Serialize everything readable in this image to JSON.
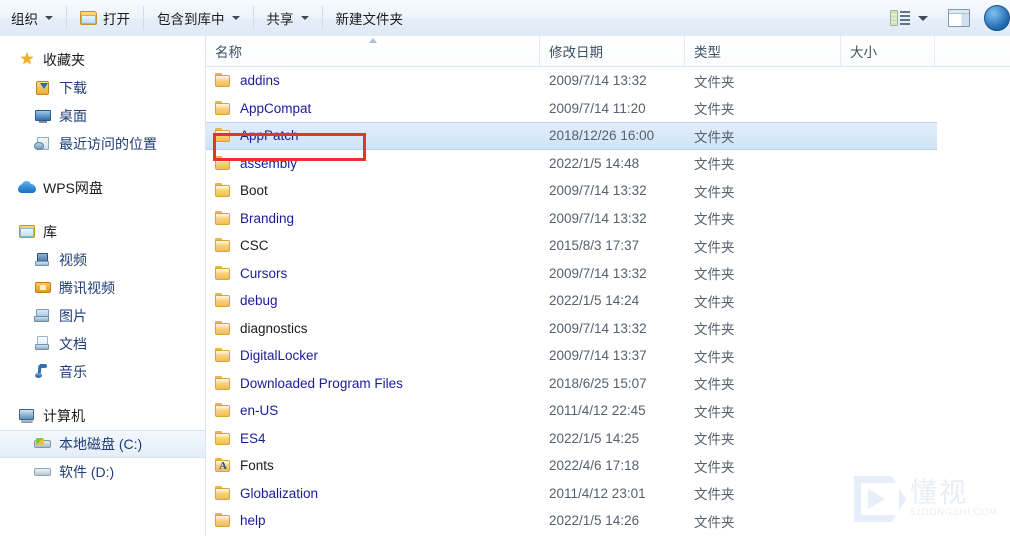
{
  "toolbar": {
    "items": [
      {
        "label": "组织",
        "icon": "none",
        "caret": true
      },
      {
        "label": "打开",
        "icon": "open-folder-icon",
        "caret": false
      },
      {
        "label": "包含到库中",
        "icon": "none",
        "caret": true
      },
      {
        "label": "共享",
        "icon": "none",
        "caret": true
      },
      {
        "label": "新建文件夹",
        "icon": "none",
        "caret": false
      }
    ],
    "right": {
      "view_icon": "view-mode-icon",
      "view_caret": "chevron-down-icon",
      "preview_pane_icon": "preview-pane-icon",
      "help_icon": "help-icon"
    }
  },
  "sidebar": {
    "groups": [
      {
        "root": {
          "label": "收藏夹",
          "icon": "star-icon"
        },
        "children": [
          {
            "label": "下载",
            "icon": "download-icon"
          },
          {
            "label": "桌面",
            "icon": "desktop-icon"
          },
          {
            "label": "最近访问的位置",
            "icon": "recent-places-icon"
          }
        ]
      },
      {
        "root": {
          "label": "WPS网盘",
          "icon": "cloud-icon"
        },
        "children": []
      },
      {
        "root": {
          "label": "库",
          "icon": "library-icon"
        },
        "children": [
          {
            "label": "视频",
            "icon": "video-icon"
          },
          {
            "label": "腾讯视频",
            "icon": "folder-orange-icon"
          },
          {
            "label": "图片",
            "icon": "pictures-icon"
          },
          {
            "label": "文档",
            "icon": "documents-icon"
          },
          {
            "label": "音乐",
            "icon": "music-icon"
          }
        ]
      },
      {
        "root": {
          "label": "计算机",
          "icon": "computer-icon"
        },
        "children": [
          {
            "label": "本地磁盘 (C:)",
            "icon": "hard-drive-windows-icon",
            "selected": true
          },
          {
            "label": "软件 (D:)",
            "icon": "hard-drive-icon",
            "selected": false
          }
        ]
      }
    ]
  },
  "file_list": {
    "columns": [
      {
        "label": "名称",
        "sorted": "asc"
      },
      {
        "label": "修改日期",
        "sorted": "none"
      },
      {
        "label": "类型",
        "sorted": "none"
      },
      {
        "label": "大小",
        "sorted": "none"
      }
    ],
    "rows": [
      {
        "name": "addins",
        "date": "2009/7/14 13:32",
        "type": "文件夹",
        "size": "",
        "icon": "folder-icon",
        "name_color": "blue",
        "selected": false
      },
      {
        "name": "AppCompat",
        "date": "2009/7/14 11:20",
        "type": "文件夹",
        "size": "",
        "icon": "folder-icon",
        "name_color": "blue",
        "selected": false
      },
      {
        "name": "AppPatch",
        "date": "2018/12/26 16:00",
        "type": "文件夹",
        "size": "",
        "icon": "folder-icon",
        "name_color": "blue",
        "selected": true
      },
      {
        "name": "assembly",
        "date": "2022/1/5 14:48",
        "type": "文件夹",
        "size": "",
        "icon": "folder-icon",
        "name_color": "blue",
        "selected": false
      },
      {
        "name": "Boot",
        "date": "2009/7/14 13:32",
        "type": "文件夹",
        "size": "",
        "icon": "folder-icon",
        "name_color": "dark",
        "selected": false
      },
      {
        "name": "Branding",
        "date": "2009/7/14 13:32",
        "type": "文件夹",
        "size": "",
        "icon": "folder-icon",
        "name_color": "blue",
        "selected": false
      },
      {
        "name": "CSC",
        "date": "2015/8/3 17:37",
        "type": "文件夹",
        "size": "",
        "icon": "folder-icon",
        "name_color": "dark",
        "selected": false
      },
      {
        "name": "Cursors",
        "date": "2009/7/14 13:32",
        "type": "文件夹",
        "size": "",
        "icon": "folder-icon",
        "name_color": "blue",
        "selected": false
      },
      {
        "name": "debug",
        "date": "2022/1/5 14:24",
        "type": "文件夹",
        "size": "",
        "icon": "folder-icon",
        "name_color": "blue",
        "selected": false
      },
      {
        "name": "diagnostics",
        "date": "2009/7/14 13:32",
        "type": "文件夹",
        "size": "",
        "icon": "folder-icon",
        "name_color": "dark",
        "selected": false
      },
      {
        "name": "DigitalLocker",
        "date": "2009/7/14 13:37",
        "type": "文件夹",
        "size": "",
        "icon": "folder-icon",
        "name_color": "blue",
        "selected": false
      },
      {
        "name": "Downloaded Program Files",
        "date": "2018/6/25 15:07",
        "type": "文件夹",
        "size": "",
        "icon": "folder-icon",
        "name_color": "blue",
        "selected": false
      },
      {
        "name": "en-US",
        "date": "2011/4/12 22:45",
        "type": "文件夹",
        "size": "",
        "icon": "folder-icon",
        "name_color": "blue",
        "selected": false
      },
      {
        "name": "ES4",
        "date": "2022/1/5 14:25",
        "type": "文件夹",
        "size": "",
        "icon": "folder-icon",
        "name_color": "blue",
        "selected": false
      },
      {
        "name": "Fonts",
        "date": "2022/4/6 17:18",
        "type": "文件夹",
        "size": "",
        "icon": "fonts-folder-icon",
        "name_color": "dark",
        "selected": false
      },
      {
        "name": "Globalization",
        "date": "2011/4/12 23:01",
        "type": "文件夹",
        "size": "",
        "icon": "folder-icon",
        "name_color": "blue",
        "selected": false
      },
      {
        "name": "help",
        "date": "2022/1/5 14:26",
        "type": "文件夹",
        "size": "",
        "icon": "folder-icon",
        "name_color": "blue",
        "selected": false
      }
    ]
  },
  "annotation": {
    "highlight_target": "AppPatch",
    "color": "#e8332a"
  },
  "watermark": {
    "cn": "懂视",
    "en": "51DONGSHI.COM"
  }
}
